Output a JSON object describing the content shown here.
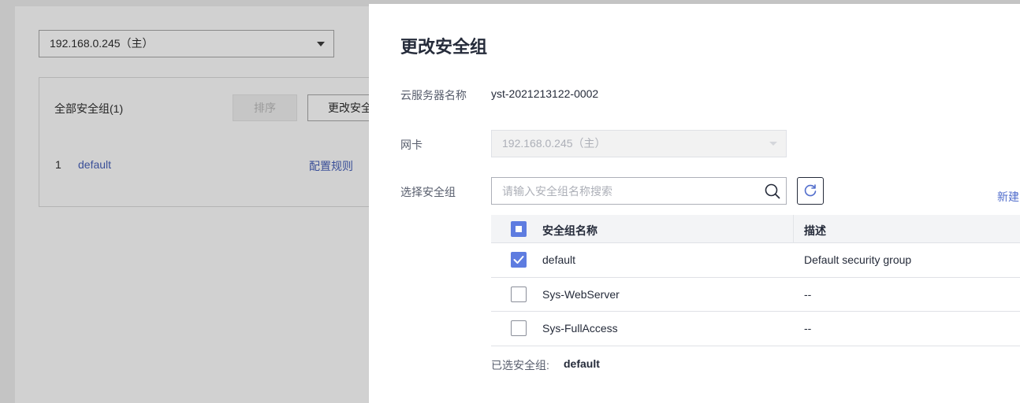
{
  "background": {
    "nic_select_value": "192.168.0.245（主）",
    "panel_title": "全部安全组(1)",
    "sort_button": "排序",
    "change_button": "更改安全组",
    "row": {
      "index": "1",
      "name": "default",
      "action": "配置规则"
    }
  },
  "drawer": {
    "title": "更改安全组",
    "server_name_label": "云服务器名称",
    "server_name_value": "yst-2021213122-0002",
    "nic_label": "网卡",
    "nic_value": "192.168.0.245（主）",
    "sg_label": "选择安全组",
    "search_placeholder": "请输入安全组名称搜索",
    "create_link": "新建",
    "table": {
      "col_name": "安全组名称",
      "col_desc": "描述",
      "rows": [
        {
          "name": "default",
          "description": "Default security group",
          "checked": true
        },
        {
          "name": "Sys-WebServer",
          "description": "--",
          "checked": false
        },
        {
          "name": "Sys-FullAccess",
          "description": "--",
          "checked": false
        }
      ]
    },
    "selected_label": "已选安全组:",
    "selected_value": "default",
    "colors": {
      "accent": "#5e7ce0",
      "link": "#526ecc",
      "text": "#252b3a"
    }
  }
}
